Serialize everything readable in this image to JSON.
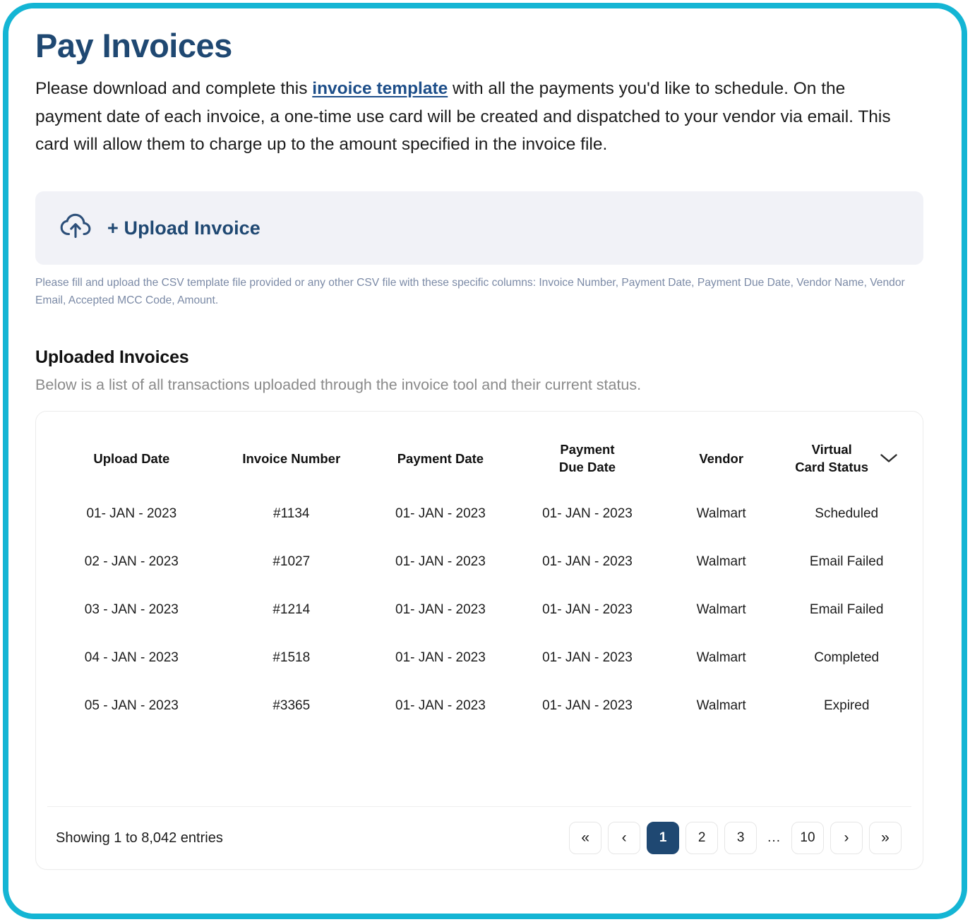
{
  "frame": {
    "accent_color": "#14b5d4"
  },
  "header": {
    "title": "Pay Invoices",
    "intro_before": "Please download and complete this ",
    "intro_link": "invoice template",
    "intro_after": " with all the payments you'd like to schedule. On the payment date of each invoice, a one-time use card will be created and dispatched to your vendor via email. This card will allow them to charge up to the amount specified in the invoice file."
  },
  "upload": {
    "icon": "cloud-upload-icon",
    "label": "+ Upload Invoice",
    "note": "Please fill and upload the CSV template file provided or any other CSV file with these specific columns: Invoice Number, Payment Date, Payment Due Date, Vendor Name, Vendor Email, Accepted MCC Code, Amount."
  },
  "section": {
    "title": "Uploaded Invoices",
    "subtitle": "Below is a list of all transactions uploaded through the invoice tool and their current status."
  },
  "table": {
    "columns": [
      {
        "label": "Upload Date"
      },
      {
        "label": "Invoice Number"
      },
      {
        "label": "Payment Date"
      },
      {
        "label": "Payment\nDue Date",
        "line1": "Payment",
        "line2": "Due Date"
      },
      {
        "label": "Vendor"
      },
      {
        "label": "Virtual\nCard Status",
        "line1": "Virtual",
        "line2": "Card Status",
        "icon": "chevron-down-icon"
      }
    ],
    "rows": [
      {
        "upload_date": "01- JAN - 2023",
        "invoice_number": "#1134",
        "payment_date": "01- JAN - 2023",
        "payment_due_date": "01- JAN - 2023",
        "vendor": "Walmart",
        "status": "Scheduled",
        "status_class": "st-scheduled",
        "status_color": "#62b5ec"
      },
      {
        "upload_date": "02 - JAN - 2023",
        "invoice_number": "#1027",
        "payment_date": "01- JAN - 2023",
        "payment_due_date": "01- JAN - 2023",
        "vendor": "Walmart",
        "status": "Email Failed",
        "status_class": "st-email-failed",
        "status_color": "#f07a5a"
      },
      {
        "upload_date": "03 - JAN - 2023",
        "invoice_number": "#1214",
        "payment_date": "01- JAN - 2023",
        "payment_due_date": "01- JAN - 2023",
        "vendor": "Walmart",
        "status": "Email Failed",
        "status_class": "st-email-failed",
        "status_color": "#f07a5a"
      },
      {
        "upload_date": "04 - JAN - 2023",
        "invoice_number": "#1518",
        "payment_date": "01- JAN - 2023",
        "payment_due_date": "01- JAN - 2023",
        "vendor": "Walmart",
        "status": "Completed",
        "status_class": "st-completed",
        "status_color": "#8dc63f"
      },
      {
        "upload_date": "05 - JAN - 2023",
        "invoice_number": "#3365",
        "payment_date": "01- JAN - 2023",
        "payment_due_date": "01- JAN - 2023",
        "vendor": "Walmart",
        "status": "Expired",
        "status_class": "st-expired",
        "status_color": "#f4684a"
      }
    ]
  },
  "footer": {
    "entries_text": "Showing 1 to 8,042 entries",
    "pagination": [
      {
        "label": "«",
        "name": "pagination-first",
        "type": "chev"
      },
      {
        "label": "‹",
        "name": "pagination-prev",
        "type": "chev"
      },
      {
        "label": "1",
        "name": "pagination-page-1",
        "type": "page",
        "active": true
      },
      {
        "label": "2",
        "name": "pagination-page-2",
        "type": "page"
      },
      {
        "label": "3",
        "name": "pagination-page-3",
        "type": "page"
      },
      {
        "label": "...",
        "name": "pagination-ellipsis",
        "type": "ellipsis"
      },
      {
        "label": "10",
        "name": "pagination-page-10",
        "type": "page"
      },
      {
        "label": "›",
        "name": "pagination-next",
        "type": "chev"
      },
      {
        "label": "»",
        "name": "pagination-last",
        "type": "chev"
      }
    ]
  }
}
